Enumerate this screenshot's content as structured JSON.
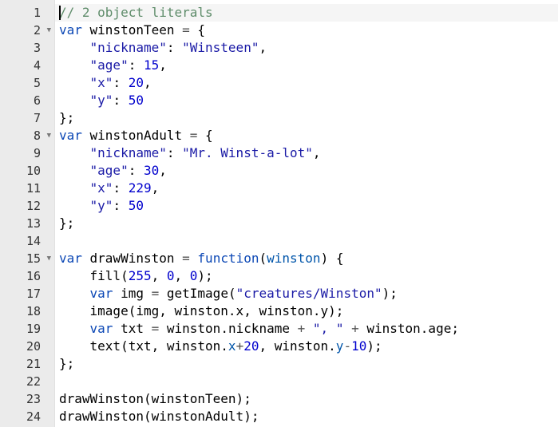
{
  "editor": {
    "colors": {
      "comment": "#5e8c6a",
      "keyword": "#0b47b5",
      "string": "#1a1aa6",
      "number": "#0000cd",
      "gutter_bg": "#ebebeb",
      "active_line_bg": "#f5f5f5"
    },
    "lines": [
      {
        "number": "1",
        "fold": false,
        "active": true,
        "cursor": true,
        "tokens": [
          {
            "t": "comment",
            "v": "// 2 object literals"
          }
        ]
      },
      {
        "number": "2",
        "fold": true,
        "tokens": [
          {
            "t": "kw",
            "v": "var"
          },
          {
            "t": "plain",
            "v": " winstonTeen "
          },
          {
            "t": "op",
            "v": "="
          },
          {
            "t": "plain",
            "v": " {"
          }
        ]
      },
      {
        "number": "3",
        "fold": false,
        "tokens": [
          {
            "t": "plain",
            "v": "    "
          },
          {
            "t": "str",
            "v": "\"nickname\""
          },
          {
            "t": "plain",
            "v": ": "
          },
          {
            "t": "str",
            "v": "\"Winsteen\""
          },
          {
            "t": "plain",
            "v": ","
          }
        ]
      },
      {
        "number": "4",
        "fold": false,
        "tokens": [
          {
            "t": "plain",
            "v": "    "
          },
          {
            "t": "str",
            "v": "\"age\""
          },
          {
            "t": "plain",
            "v": ": "
          },
          {
            "t": "num",
            "v": "15"
          },
          {
            "t": "plain",
            "v": ","
          }
        ]
      },
      {
        "number": "5",
        "fold": false,
        "tokens": [
          {
            "t": "plain",
            "v": "    "
          },
          {
            "t": "str",
            "v": "\"x\""
          },
          {
            "t": "plain",
            "v": ": "
          },
          {
            "t": "num",
            "v": "20"
          },
          {
            "t": "plain",
            "v": ","
          }
        ]
      },
      {
        "number": "6",
        "fold": false,
        "tokens": [
          {
            "t": "plain",
            "v": "    "
          },
          {
            "t": "str",
            "v": "\"y\""
          },
          {
            "t": "plain",
            "v": ": "
          },
          {
            "t": "num",
            "v": "50"
          }
        ]
      },
      {
        "number": "7",
        "fold": false,
        "tokens": [
          {
            "t": "plain",
            "v": "};"
          }
        ]
      },
      {
        "number": "8",
        "fold": true,
        "tokens": [
          {
            "t": "kw",
            "v": "var"
          },
          {
            "t": "plain",
            "v": " winstonAdult "
          },
          {
            "t": "op",
            "v": "="
          },
          {
            "t": "plain",
            "v": " {"
          }
        ]
      },
      {
        "number": "9",
        "fold": false,
        "tokens": [
          {
            "t": "plain",
            "v": "    "
          },
          {
            "t": "str",
            "v": "\"nickname\""
          },
          {
            "t": "plain",
            "v": ": "
          },
          {
            "t": "str",
            "v": "\"Mr. Winst-a-lot\""
          },
          {
            "t": "plain",
            "v": ","
          }
        ]
      },
      {
        "number": "10",
        "fold": false,
        "tokens": [
          {
            "t": "plain",
            "v": "    "
          },
          {
            "t": "str",
            "v": "\"age\""
          },
          {
            "t": "plain",
            "v": ": "
          },
          {
            "t": "num",
            "v": "30"
          },
          {
            "t": "plain",
            "v": ","
          }
        ]
      },
      {
        "number": "11",
        "fold": false,
        "tokens": [
          {
            "t": "plain",
            "v": "    "
          },
          {
            "t": "str",
            "v": "\"x\""
          },
          {
            "t": "plain",
            "v": ": "
          },
          {
            "t": "num",
            "v": "229"
          },
          {
            "t": "plain",
            "v": ","
          }
        ]
      },
      {
        "number": "12",
        "fold": false,
        "tokens": [
          {
            "t": "plain",
            "v": "    "
          },
          {
            "t": "str",
            "v": "\"y\""
          },
          {
            "t": "plain",
            "v": ": "
          },
          {
            "t": "num",
            "v": "50"
          }
        ]
      },
      {
        "number": "13",
        "fold": false,
        "tokens": [
          {
            "t": "plain",
            "v": "};"
          }
        ]
      },
      {
        "number": "14",
        "fold": false,
        "tokens": []
      },
      {
        "number": "15",
        "fold": true,
        "tokens": [
          {
            "t": "kw",
            "v": "var"
          },
          {
            "t": "plain",
            "v": " drawWinston "
          },
          {
            "t": "op",
            "v": "="
          },
          {
            "t": "plain",
            "v": " "
          },
          {
            "t": "kw",
            "v": "function"
          },
          {
            "t": "plain",
            "v": "("
          },
          {
            "t": "var",
            "v": "winston"
          },
          {
            "t": "plain",
            "v": ") {"
          }
        ]
      },
      {
        "number": "16",
        "fold": false,
        "tokens": [
          {
            "t": "plain",
            "v": "    fill("
          },
          {
            "t": "num",
            "v": "255"
          },
          {
            "t": "plain",
            "v": ", "
          },
          {
            "t": "num",
            "v": "0"
          },
          {
            "t": "plain",
            "v": ", "
          },
          {
            "t": "num",
            "v": "0"
          },
          {
            "t": "plain",
            "v": ");"
          }
        ]
      },
      {
        "number": "17",
        "fold": false,
        "tokens": [
          {
            "t": "plain",
            "v": "    "
          },
          {
            "t": "kw",
            "v": "var"
          },
          {
            "t": "plain",
            "v": " img "
          },
          {
            "t": "op",
            "v": "="
          },
          {
            "t": "plain",
            "v": " getImage("
          },
          {
            "t": "str",
            "v": "\"creatures/Winston\""
          },
          {
            "t": "plain",
            "v": ");"
          }
        ]
      },
      {
        "number": "18",
        "fold": false,
        "tokens": [
          {
            "t": "plain",
            "v": "    image(img, winston.x, winston.y);"
          }
        ]
      },
      {
        "number": "19",
        "fold": false,
        "tokens": [
          {
            "t": "plain",
            "v": "    "
          },
          {
            "t": "kw",
            "v": "var"
          },
          {
            "t": "plain",
            "v": " txt "
          },
          {
            "t": "op",
            "v": "="
          },
          {
            "t": "plain",
            "v": " winston.nickname "
          },
          {
            "t": "op",
            "v": "+"
          },
          {
            "t": "plain",
            "v": " "
          },
          {
            "t": "str",
            "v": "\", \""
          },
          {
            "t": "plain",
            "v": " "
          },
          {
            "t": "op",
            "v": "+"
          },
          {
            "t": "plain",
            "v": " winston.age;"
          }
        ]
      },
      {
        "number": "20",
        "fold": false,
        "tokens": [
          {
            "t": "plain",
            "v": "    text(txt, winston."
          },
          {
            "t": "var",
            "v": "x"
          },
          {
            "t": "op",
            "v": "+"
          },
          {
            "t": "num",
            "v": "20"
          },
          {
            "t": "plain",
            "v": ", winston."
          },
          {
            "t": "var",
            "v": "y"
          },
          {
            "t": "op",
            "v": "-"
          },
          {
            "t": "num",
            "v": "10"
          },
          {
            "t": "plain",
            "v": ");"
          }
        ]
      },
      {
        "number": "21",
        "fold": false,
        "tokens": [
          {
            "t": "plain",
            "v": "};"
          }
        ]
      },
      {
        "number": "22",
        "fold": false,
        "tokens": []
      },
      {
        "number": "23",
        "fold": false,
        "tokens": [
          {
            "t": "plain",
            "v": "drawWinston(winstonTeen);"
          }
        ]
      },
      {
        "number": "24",
        "fold": false,
        "tokens": [
          {
            "t": "plain",
            "v": "drawWinston(winstonAdult);"
          }
        ]
      }
    ]
  }
}
